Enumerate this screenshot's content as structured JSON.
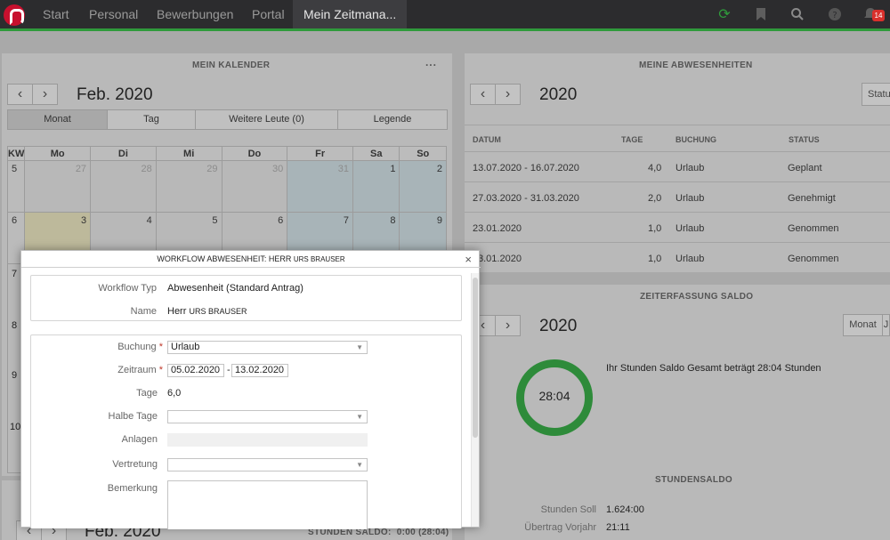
{
  "nav": {
    "items": [
      "Start",
      "Personal",
      "Bewerbungen",
      "Portal",
      "Mein Zeitmana..."
    ],
    "badge_count": "14",
    "icons": [
      "refresh-icon",
      "bookmark-icon",
      "search-icon",
      "help-icon",
      "bell-icon"
    ]
  },
  "calendar": {
    "title": "MEIN KALENDER",
    "menu": "···",
    "prev": "‹",
    "next": "›",
    "month": "Feb. 2020",
    "tabs": [
      "Monat",
      "Tag",
      "Weitere Leute (0)",
      "Legende"
    ],
    "headers": [
      "KW",
      "Mo",
      "Di",
      "Mi",
      "Do",
      "Fr",
      "Sa",
      "So"
    ],
    "rows": [
      [
        "5",
        "27",
        "28",
        "29",
        "30",
        "31",
        "1",
        "2"
      ],
      [
        "6",
        "3",
        "4",
        "5",
        "6",
        "7",
        "8",
        "9"
      ]
    ],
    "hidden_weeks": [
      "7",
      "8",
      "9",
      "10"
    ]
  },
  "absences": {
    "title": "MEINE ABWESENHEITEN",
    "prev": "‹",
    "next": "›",
    "year": "2020",
    "status_btn": "Statu",
    "columns": [
      "DATUM",
      "TAGE",
      "BUCHUNG",
      "STATUS"
    ],
    "rows": [
      {
        "datum": "13.07.2020 - 16.07.2020",
        "tage": "4,0",
        "buchung": "Urlaub",
        "status": "Geplant"
      },
      {
        "datum": "27.03.2020 - 31.03.2020",
        "tage": "2,0",
        "buchung": "Urlaub",
        "status": "Genehmigt"
      },
      {
        "datum": "23.01.2020",
        "tage": "1,0",
        "buchung": "Urlaub",
        "status": "Genommen"
      },
      {
        "datum": "3.01.2020",
        "tage": "1,0",
        "buchung": "Urlaub",
        "status": "Genommen"
      }
    ]
  },
  "saldo": {
    "title": "ZEITERFASSUNG SALDO",
    "prev": "‹",
    "next": "›",
    "year": "2020",
    "btn_monat": "Monat",
    "btn_j": "J",
    "donut_value": "28:04",
    "summary": "Ihr Stunden Saldo Gesamt beträgt 28:04 Stunden",
    "section": "STUNDENSALDO",
    "soll_label": "Stunden Soll",
    "soll_value": "1.624:00",
    "vorjahr_label": "Übertrag Vorjahr",
    "vorjahr_value": "21:11"
  },
  "bottom": {
    "prev": "‹",
    "next": "›",
    "month": "Feb. 2020",
    "saldo_text": "STUNDEN SALDO:  0:00 (28:04)"
  },
  "modal": {
    "title": "WORKFLOW ABWESENHEIT: HERR",
    "title_name": "URS BRAUSER",
    "close": "×",
    "workflow_label": "Workflow Typ",
    "workflow_value": "Abwesenheit (Standard Antrag)",
    "name_label": "Name",
    "name_value": "Herr",
    "name_small": "URS BRAUSER",
    "buchung_label": "Buchung",
    "buchung_value": "Urlaub",
    "zeitraum_label": "Zeitraum",
    "zeitraum_from": "05.02.2020",
    "zeitraum_sep": "-",
    "zeitraum_to": "13.02.2020",
    "tage_label": "Tage",
    "tage_value": "6,0",
    "halbe_label": "Halbe Tage",
    "anlagen_label": "Anlagen",
    "vertretung_label": "Vertretung",
    "bemerkung_label": "Bemerkung",
    "required_mark": "*"
  }
}
